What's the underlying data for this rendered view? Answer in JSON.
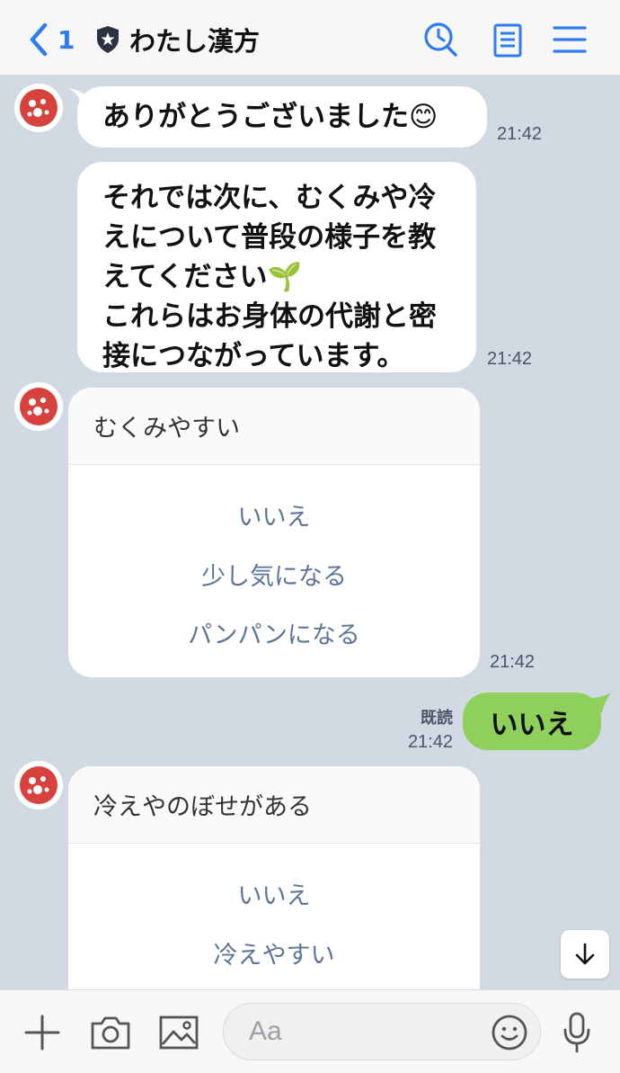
{
  "header": {
    "unread_count": "1",
    "title": "わたし漢方"
  },
  "messages": {
    "m1": {
      "text": "ありがとうございました😊",
      "time": "21:42"
    },
    "m2": {
      "text": "それでは次に、むくみや冷\nえについて普段の様子を教\nえてください🌱\nこれらはお身体の代謝と密\n接につながっています。",
      "time": "21:42"
    },
    "card1": {
      "question": "むくみやすい",
      "options": [
        "いいえ",
        "少し気になる",
        "パンパンになる"
      ],
      "time": "21:42"
    },
    "mine1": {
      "text": "いいえ",
      "read_label": "既読",
      "time": "21:42"
    },
    "card2": {
      "question": "冷えやのぼせがある",
      "options": [
        "いいえ",
        "冷えやすい"
      ]
    }
  },
  "composer": {
    "placeholder": "Aa"
  },
  "colors": {
    "accent": "#2f7bf0",
    "chat_bg": "#d1d9e3",
    "my_bubble": "#8ed05a",
    "option_text": "#5c7598",
    "avatar_red": "#d8423d"
  },
  "icons": [
    "back-chevron-icon",
    "shield-star-icon",
    "search-history-icon",
    "notes-icon",
    "menu-icon",
    "plus-icon",
    "camera-icon",
    "image-icon",
    "emoji-icon",
    "microphone-icon",
    "arrow-down-icon"
  ]
}
